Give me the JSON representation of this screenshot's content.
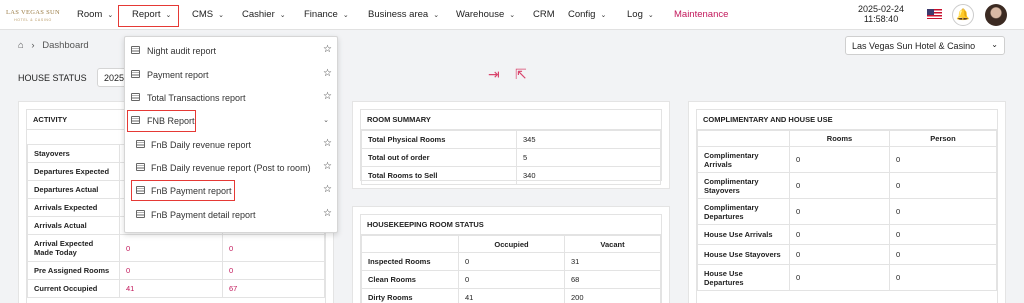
{
  "header": {
    "logo_text": "LAS VEGAS SUN",
    "logo_sub": "HOTEL & CASINO",
    "nav": [
      {
        "label": "Room",
        "chevron": true
      },
      {
        "label": "Report",
        "chevron": true
      },
      {
        "label": "CMS",
        "chevron": true
      },
      {
        "label": "Cashier",
        "chevron": true
      },
      {
        "label": "Finance",
        "chevron": true
      },
      {
        "label": "Business area",
        "chevron": true
      },
      {
        "label": "Warehouse",
        "chevron": true
      },
      {
        "label": "CRM",
        "chevron": false
      },
      {
        "label": "Config",
        "chevron": true
      },
      {
        "label": "Log",
        "chevron": true
      },
      {
        "label": "Maintenance",
        "chevron": false
      }
    ],
    "date": "2025-02-24",
    "time": "11:58:40",
    "accent": "#c2185b"
  },
  "breadcrumb": {
    "label": "Dashboard"
  },
  "hotel_select": {
    "value": "Las Vegas Sun Hotel & Casino"
  },
  "house_status": {
    "label": "HOUSE STATUS",
    "date_value": "2025"
  },
  "report_menu": {
    "items": [
      {
        "label": "Night audit report",
        "star": true
      },
      {
        "label": "Payment report",
        "star": true
      },
      {
        "label": "Total Transactions report",
        "star": true
      },
      {
        "label": "FNB Report",
        "expandable": true
      },
      {
        "label": "FnB Daily revenue report",
        "star": true
      },
      {
        "label": "FnB Daily revenue report (Post to room)",
        "star": true
      },
      {
        "label": "FnB Payment report",
        "star": true
      },
      {
        "label": "FnB Payment detail report",
        "star": true
      }
    ]
  },
  "activity": {
    "title": "ACTIVITY",
    "rows": [
      {
        "label": "Stayovers",
        "a": "",
        "b": ""
      },
      {
        "label": "Departures Expected",
        "a": "",
        "b": ""
      },
      {
        "label": "Departures Actual",
        "a": "",
        "b": ""
      },
      {
        "label": "Arrivals Expected",
        "a": "",
        "b": ""
      },
      {
        "label": "Arrivals Actual",
        "a": "",
        "b": ""
      },
      {
        "label": "Arrival Expected Made Today",
        "a": "0",
        "b": "0"
      },
      {
        "label": "Pre Assigned Rooms",
        "a": "0",
        "b": "0"
      },
      {
        "label": "Current Occupied",
        "a": "41",
        "b": "67"
      }
    ]
  },
  "room_summary": {
    "title": "ROOM SUMMARY",
    "rows": [
      {
        "label": "Total Physical Rooms",
        "value": "345"
      },
      {
        "label": "Total out of order",
        "value": "5"
      },
      {
        "label": "Total Rooms to Sell",
        "value": "340"
      }
    ]
  },
  "housekeeping": {
    "title": "HOUSEKEEPING ROOM STATUS",
    "columns": [
      "Occupied",
      "Vacant"
    ],
    "rows": [
      {
        "label": "Inspected Rooms",
        "occupied": "0",
        "vacant": "31"
      },
      {
        "label": "Clean Rooms",
        "occupied": "0",
        "vacant": "68"
      },
      {
        "label": "Dirty Rooms",
        "occupied": "41",
        "vacant": "200"
      }
    ]
  },
  "complimentary": {
    "title": "COMPLIMENTARY AND HOUSE USE",
    "columns": [
      "Rooms",
      "Person"
    ],
    "rows": [
      {
        "label": "Complimentary Arrivals",
        "rooms": "0",
        "person": "0"
      },
      {
        "label": "Complimentary Stayovers",
        "rooms": "0",
        "person": "0"
      },
      {
        "label": "Complimentary Departures",
        "rooms": "0",
        "person": "0"
      },
      {
        "label": "House Use Arrivals",
        "rooms": "0",
        "person": "0"
      },
      {
        "label": "House Use Stayovers",
        "rooms": "0",
        "person": "0"
      },
      {
        "label": "House Use Departures",
        "rooms": "0",
        "person": "0"
      }
    ]
  }
}
